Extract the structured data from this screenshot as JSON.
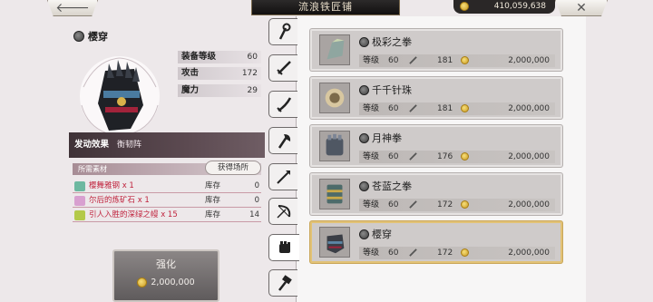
{
  "header": {
    "title": "流浪铁匠铺",
    "money": "410,059,638",
    "back_symbol": "🡐",
    "close_symbol": "✕"
  },
  "selected_item": {
    "name": "樱穿",
    "stats": [
      {
        "label": "装备等级",
        "value": "60"
      },
      {
        "label": "攻击",
        "value": "172"
      },
      {
        "label": "魔力",
        "value": "29"
      }
    ],
    "effect_label": "发动效果",
    "effect_value": "衡韧阵",
    "materials_header": "所需素材",
    "obtain_button": "获得场所",
    "materials": [
      {
        "name": "樱舞雅钢 x 1",
        "stock_label": "库存",
        "count": "0",
        "icon_color": "#6db8a0"
      },
      {
        "name": "尔后的炼矿石 x 1",
        "stock_label": "库存",
        "count": "0",
        "icon_color": "#d8a0d0"
      },
      {
        "name": "引人入胜的深绿之幔 x 15",
        "stock_label": "库存",
        "count": "14",
        "icon_color": "#b3c94a"
      }
    ],
    "enhance_label": "强化",
    "enhance_cost": "2,000,000"
  },
  "tabs": [
    {
      "name": "staff",
      "icon": "staff-icon"
    },
    {
      "name": "sword",
      "icon": "sword-icon"
    },
    {
      "name": "katana",
      "icon": "katana-icon"
    },
    {
      "name": "axe",
      "icon": "axe-icon"
    },
    {
      "name": "spear",
      "icon": "spear-icon"
    },
    {
      "name": "bow",
      "icon": "bow-icon"
    },
    {
      "name": "fist",
      "icon": "fist-icon",
      "active": true
    },
    {
      "name": "hammer",
      "icon": "hammer-icon"
    }
  ],
  "list_labels": {
    "level": "等级"
  },
  "weapons": [
    {
      "name": "极彩之拳",
      "level": "60",
      "attack": "181",
      "price": "2,000,000"
    },
    {
      "name": "千千针珠",
      "level": "60",
      "attack": "181",
      "price": "2,000,000"
    },
    {
      "name": "月神拳",
      "level": "60",
      "attack": "176",
      "price": "2,000,000"
    },
    {
      "name": "苍蓝之拳",
      "level": "60",
      "attack": "172",
      "price": "2,000,000"
    },
    {
      "name": "樱穿",
      "level": "60",
      "attack": "172",
      "price": "2,000,000",
      "selected": true
    }
  ]
}
